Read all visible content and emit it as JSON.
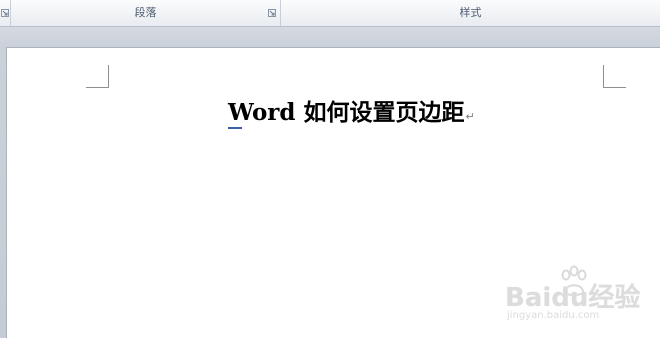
{
  "ribbon": {
    "groups": [
      {
        "label": "段落",
        "has_launcher": true
      },
      {
        "label": "样式",
        "has_launcher": false
      }
    ]
  },
  "document": {
    "title": "Word 如何设置页边距",
    "paragraph_mark": "↵"
  },
  "watermark": {
    "logo_text": "Baidu经验",
    "url": "jingyan.baidu.com"
  }
}
